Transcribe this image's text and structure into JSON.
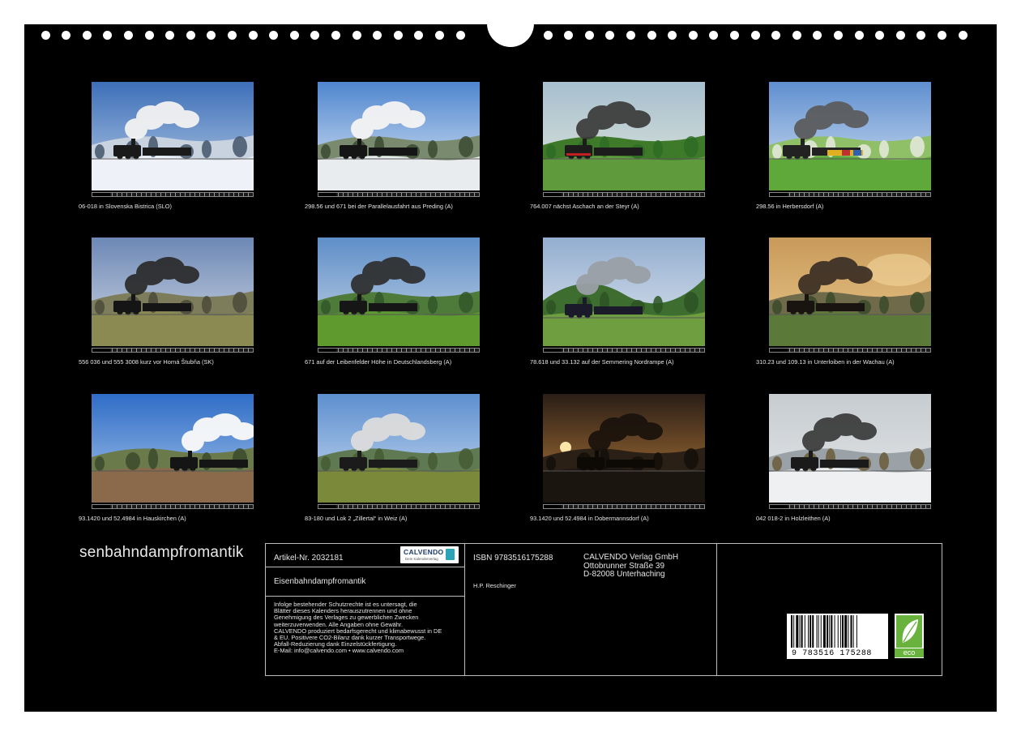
{
  "calendar": {
    "side_title": "senbahndampfromantik",
    "months": [
      {
        "caption": "06-018 in Slovenska Bistrica (SLO)",
        "scene": "winter"
      },
      {
        "caption": "298.56 und 671 bei der Parallelausfahrt aus Preding (A)",
        "scene": "snowpair"
      },
      {
        "caption": "764.007 nächst Aschach an der Steyr (A)",
        "scene": "forest"
      },
      {
        "caption": "298.56 in Herbersdorf (A)",
        "scene": "spring"
      },
      {
        "caption": "556 036 und 555 3008 kurz vor Horná Štubňa (SK)",
        "scene": "blacksmoke"
      },
      {
        "caption": "671 auf der Leibenfelder Höhe in Deutschlandsberg (A)",
        "scene": "greenhill"
      },
      {
        "caption": "78.618 und 33.132 auf der Semmering Nordrampe (A)",
        "scene": "mountain"
      },
      {
        "caption": "310.23 und 109.13 in Unterloiben in der Wachau (A)",
        "scene": "sunset"
      },
      {
        "caption": "93.1420 und 52.4984 in Hauskirchen (A)",
        "scene": "whitesmoke"
      },
      {
        "caption": "83-180 und Lok 2 „Zillertal“ in Weiz (A)",
        "scene": "town"
      },
      {
        "caption": "93.1420 und 52.4984 in Dobermannsdorf (A)",
        "scene": "dusk"
      },
      {
        "caption": "042 018-2 in Holzleithen (A)",
        "scene": "snowfall"
      }
    ]
  },
  "imprint": {
    "article_label": "Artikel-Nr. 2032181",
    "logo_text": "CALVENDO",
    "logo_sub": "Dein Kalenderverlag",
    "product_title": "Eisenbahndampfromantik",
    "legal_lines": [
      "Infolge bestehender Schutzrechte ist es untersagt, die",
      "Blätter dieses Kalenders herauszutrennen und ohne",
      "Genehmigung des Verlages zu gewerblichen Zwecken",
      "weiterzuverwenden. Alle Angaben ohne Gewähr.",
      "CALVENDO produziert bedarfsgerecht und klimabewusst in DE",
      "& EU. Positivere CO2-Bilanz dank kurzer Transportwege.",
      "Abfall-Reduzierung dank Einzelstückfertigung.",
      "E-Mail: info@calvendo.com • www.calvendo.com"
    ],
    "isbn": "ISBN 9783516175288",
    "author": "H.P. Reschinger",
    "publisher_lines": [
      "CALVENDO Verlag GmbH",
      "Ottobrunner Straße 39",
      "D-82008 Unterhaching"
    ],
    "barcode_digits": "9 783516 175288",
    "eco_label": "eco"
  }
}
